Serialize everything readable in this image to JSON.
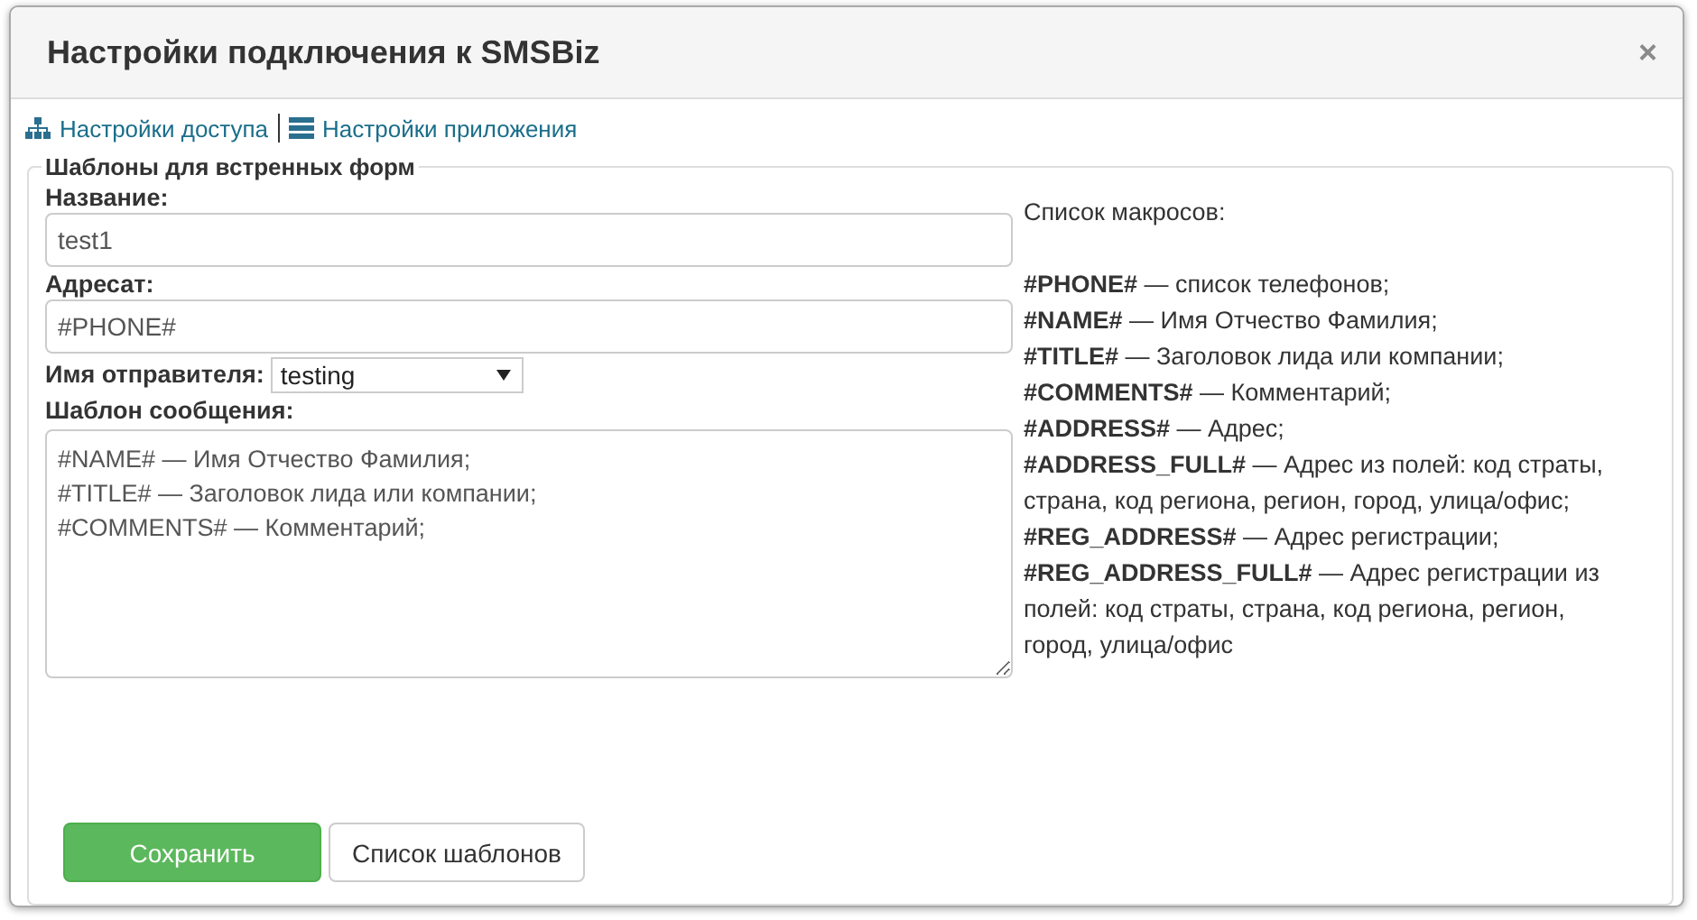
{
  "dialog": {
    "title": "Настройки подключения к SMSBiz",
    "close": "×"
  },
  "nav": [
    {
      "kind": "access",
      "label": "Настройки доступа"
    },
    {
      "kind": "app",
      "label": "Настройки приложения"
    }
  ],
  "fieldset": {
    "legend": "Шаблоны для встренных форм",
    "name": {
      "label": "Название:",
      "value": "test1"
    },
    "recipient": {
      "label": "Адресат:",
      "value": "#PHONE#"
    },
    "sender": {
      "label": "Имя отправителя:",
      "value": "testing"
    },
    "template": {
      "label": "Шаблон сообщения:",
      "value": "#NAME# — Имя Отчество Фамилия;\n#TITLE# — Заголовок лида или компании;\n#COMMENTS# — Комментарий;"
    },
    "macros": {
      "title": "Список макросов:",
      "items": [
        {
          "name": "#PHONE#",
          "text": "— список телефонов;"
        },
        {
          "name": "#NAME#",
          "text": "— Имя Отчество Фамилия;"
        },
        {
          "name": "#TITLE#",
          "text": "— Заголовок лида или компании;"
        },
        {
          "name": "#COMMENTS#",
          "text": "— Комментарий;"
        },
        {
          "name": "#ADDRESS#",
          "text": "— Адрес;"
        },
        {
          "name": "#ADDRESS_FULL#",
          "text": "— Адрес из полей: код страты, страна, код региона, регион, город, улица/офис;"
        },
        {
          "name": "#REG_ADDRESS#",
          "text": "— Адрес регистрации;"
        },
        {
          "name": "#REG_ADDRESS_FULL#",
          "text": "— Адрес регистрации из полей: код страты, страна, код региона, регион, город, улица/офис"
        }
      ]
    }
  },
  "buttons": [
    {
      "kind": "primary",
      "label": "Сохранить"
    },
    {
      "kind": "default",
      "label": "Список шаблонов"
    }
  ]
}
